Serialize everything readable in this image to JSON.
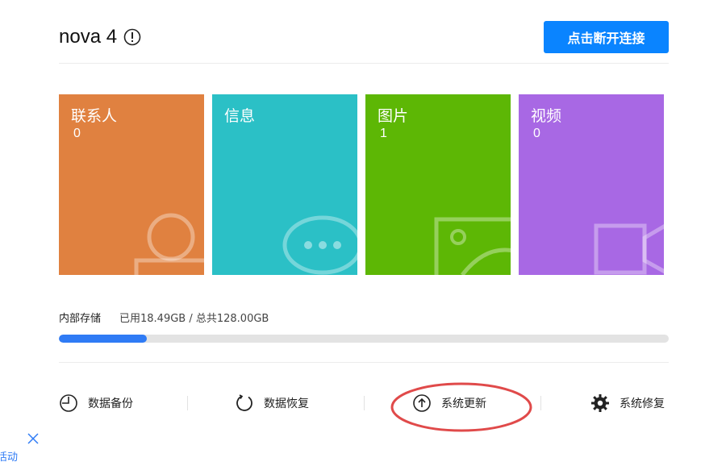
{
  "header": {
    "device_name": "nova 4",
    "disconnect_label": "点击断开连接"
  },
  "tiles": [
    {
      "title": "联系人",
      "count": "0",
      "color": "#e08140",
      "icon": "contact-icon"
    },
    {
      "title": "信息",
      "count": "",
      "color": "#2bc0c6",
      "icon": "message-icon"
    },
    {
      "title": "图片",
      "count": "1",
      "color": "#5db705",
      "icon": "picture-icon"
    },
    {
      "title": "视频",
      "count": "0",
      "color": "#a868e4",
      "icon": "video-icon"
    }
  ],
  "storage": {
    "label": "内部存储",
    "usage_text": "已用18.49GB / 总共128.00GB",
    "used_fraction": 0.1445
  },
  "tools": [
    {
      "label": "数据备份",
      "icon": "backup-clock-icon"
    },
    {
      "label": "数据恢复",
      "icon": "restore-icon"
    },
    {
      "label": "系统更新",
      "icon": "upload-arrow-icon"
    },
    {
      "label": "系统修复",
      "icon": "gear-icon"
    }
  ],
  "bottom": {
    "partial_text": "活动"
  },
  "colors": {
    "accent": "#0a84ff",
    "progress": "#2f7bf5",
    "highlight": "#e04a4a"
  }
}
